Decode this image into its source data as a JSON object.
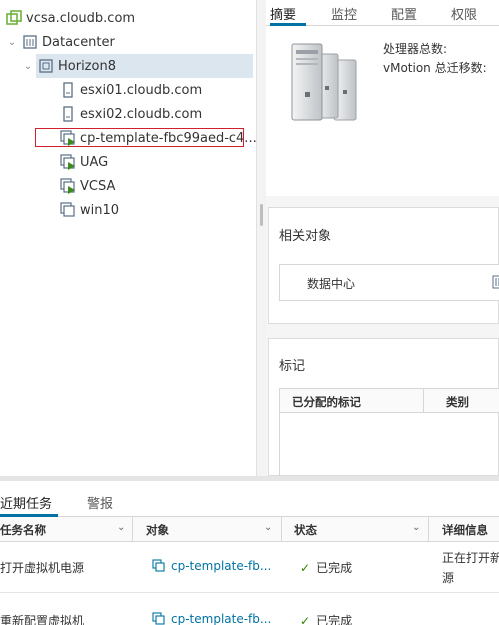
{
  "tree": {
    "items": [
      {
        "label": "vcsa.cloudb.com",
        "icon": "vcenter-icon"
      },
      {
        "label": "Datacenter",
        "icon": "datacenter-icon"
      },
      {
        "label": "Horizon8",
        "icon": "cluster-icon"
      },
      {
        "label": "esxi01.cloudb.com",
        "icon": "host-icon"
      },
      {
        "label": "esxi02.cloudb.com",
        "icon": "host-icon"
      },
      {
        "label": "cp-template-fbc99aed-c4...",
        "icon": "vm-powered-on-icon"
      },
      {
        "label": "UAG",
        "icon": "vm-powered-on-icon"
      },
      {
        "label": "VCSA",
        "icon": "vm-powered-on-icon"
      },
      {
        "label": "win10",
        "icon": "vm-icon"
      }
    ]
  },
  "tabs": [
    "摘要",
    "监控",
    "配置",
    "权限"
  ],
  "summary": {
    "cpu_label": "处理器总数:",
    "vmotion_label": "vMotion 总迁移数:"
  },
  "related": {
    "title": "相关对象",
    "item": "数据中心"
  },
  "tags": {
    "title": "标记",
    "col_assigned": "已分配的标记",
    "col_category": "类别"
  },
  "bottom": {
    "tabs": [
      "近期任务",
      "警报"
    ],
    "columns": [
      "任务名称",
      "对象",
      "状态",
      "详细信息"
    ],
    "rows": [
      {
        "task": "打开虚拟机电源",
        "object": "cp-template-fb...",
        "status": "已完成",
        "detail_1": "正在打开新",
        "detail_2": "源"
      },
      {
        "task": "重新配置虚拟机",
        "object": "cp-template-fb...",
        "status": "已完成",
        "detail_1": "",
        "detail_2": ""
      }
    ]
  },
  "colors": {
    "accent": "#0072a3",
    "selected_bg": "#dce6ef",
    "success": "#2f8400",
    "highlight_border": "#d0202e"
  }
}
